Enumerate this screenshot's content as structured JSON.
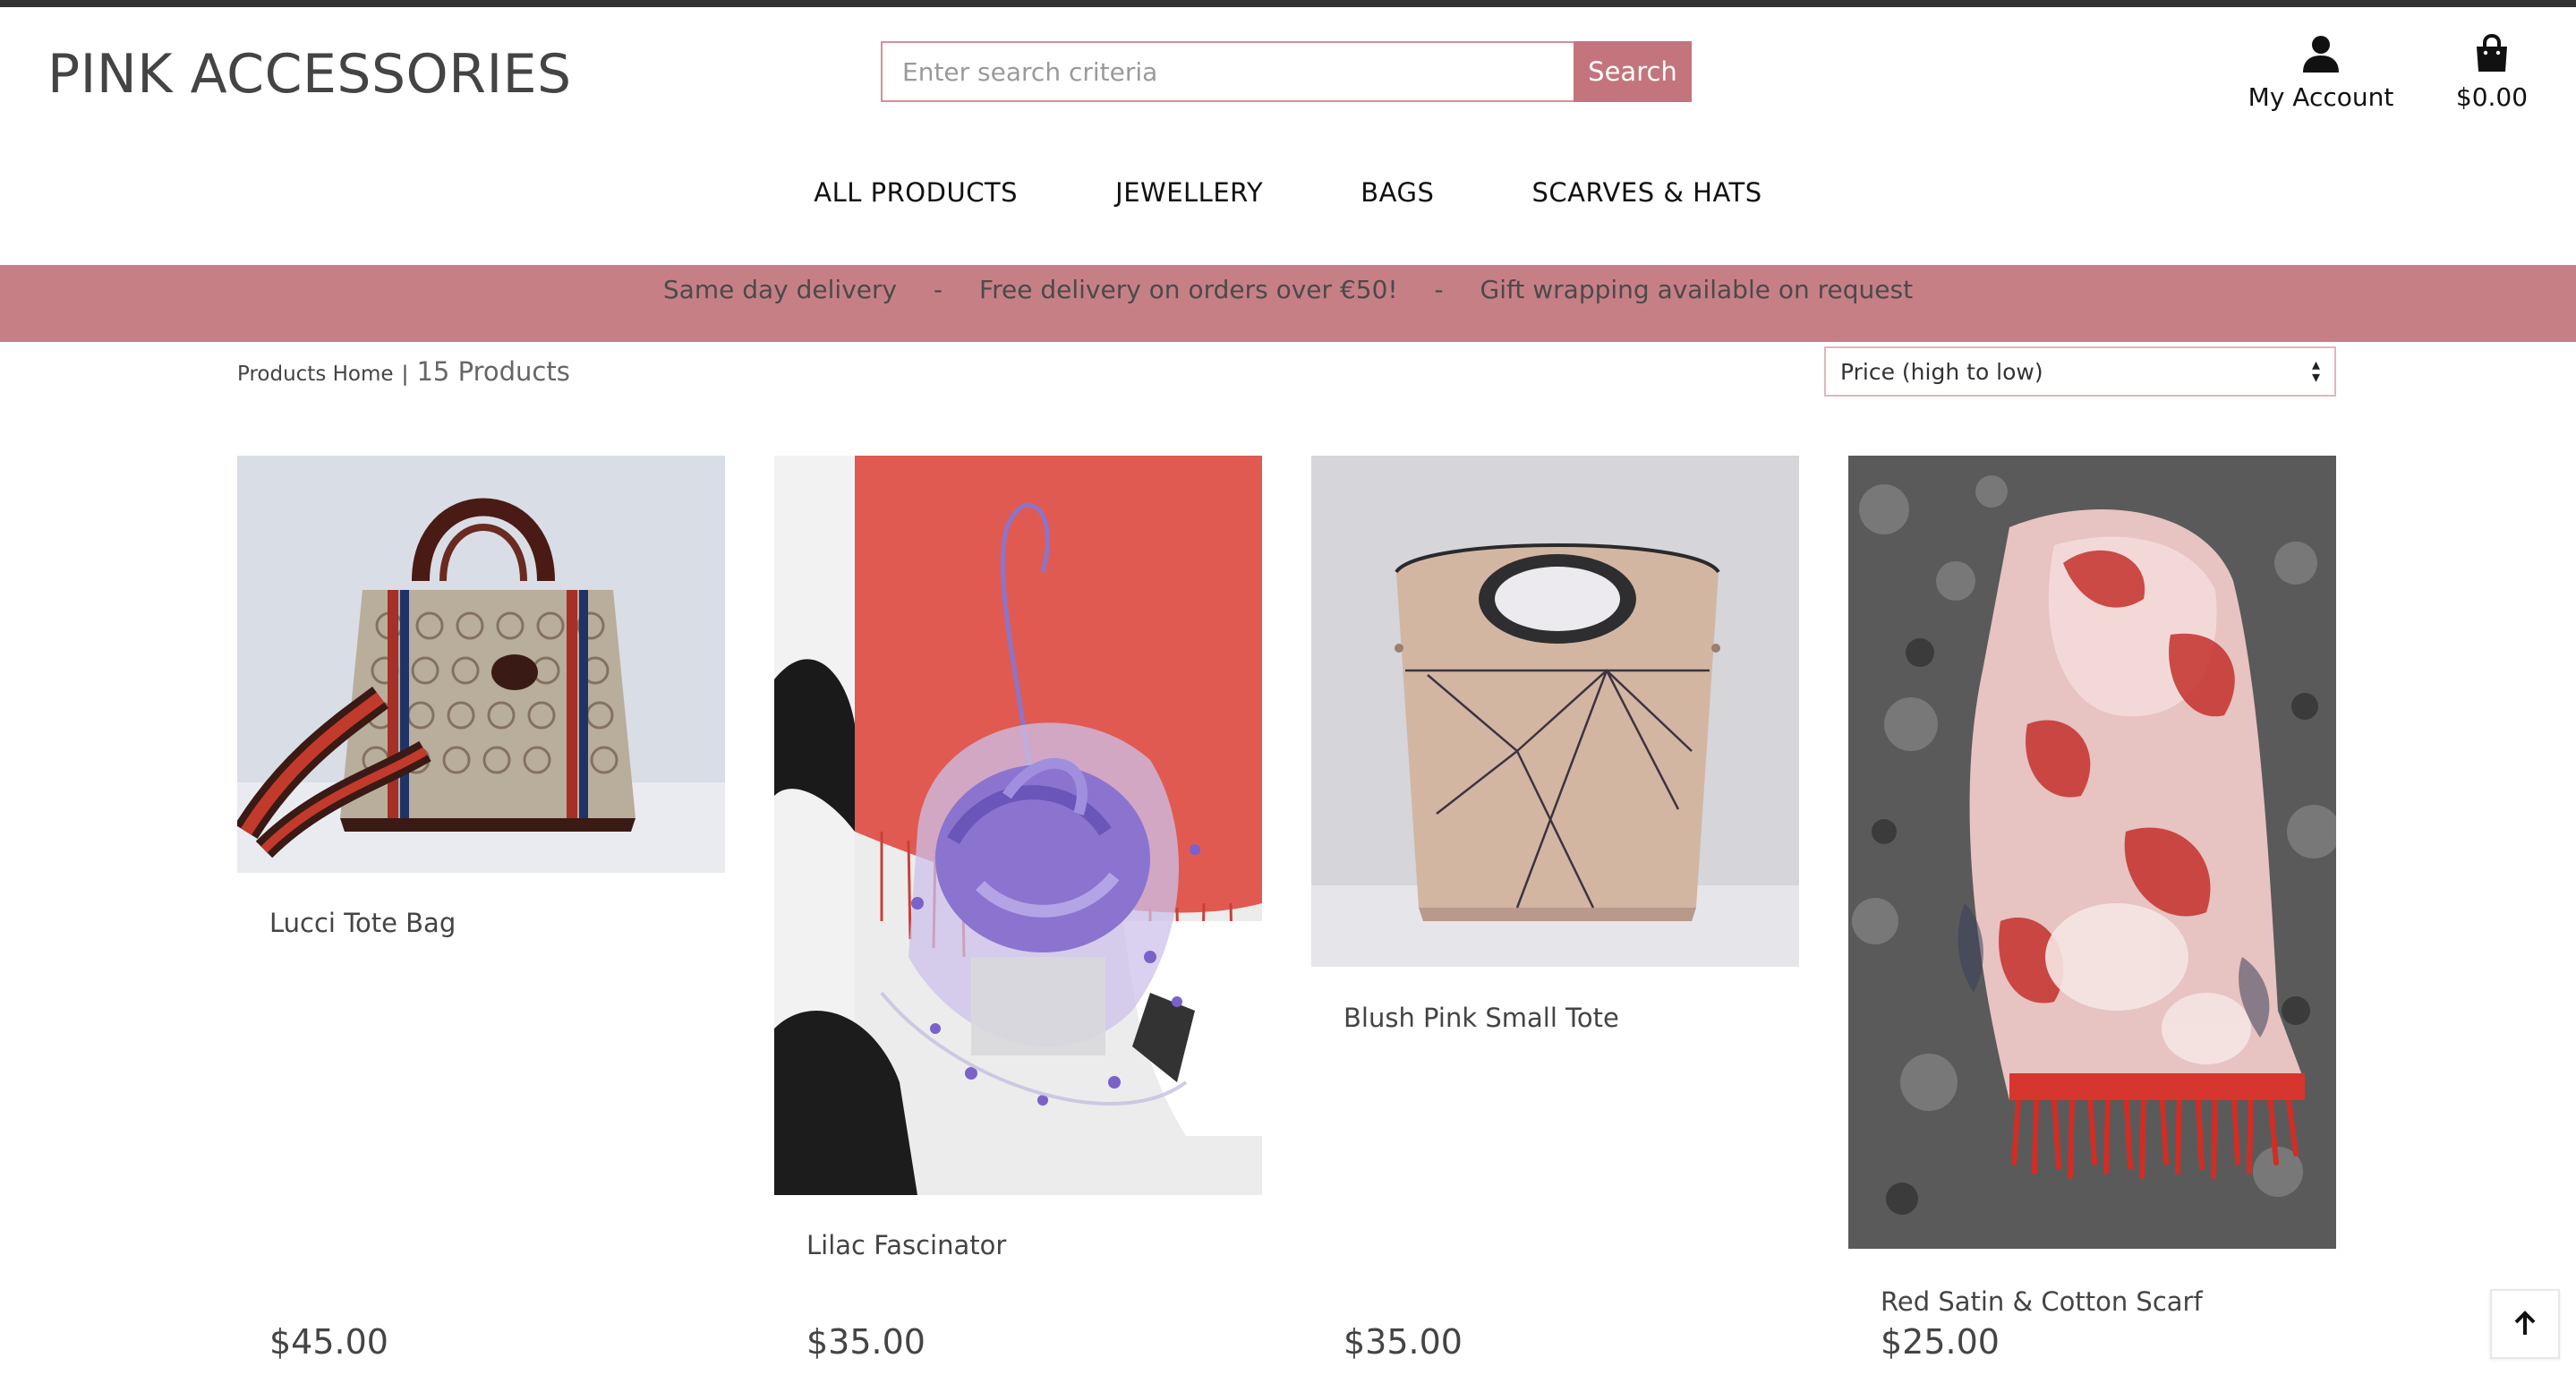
{
  "header": {
    "logo": "PINK ACCESSORIES",
    "search": {
      "placeholder": "Enter search criteria",
      "value": "",
      "button_label": "Search"
    },
    "account_label": "My Account",
    "cart_total": "$0.00"
  },
  "nav": {
    "items": [
      {
        "label": "ALL PRODUCTS"
      },
      {
        "label": "JEWELLERY"
      },
      {
        "label": "BAGS"
      },
      {
        "label": "SCARVES & HATS"
      }
    ]
  },
  "banner": {
    "messages": [
      "Same day delivery",
      "Free delivery on orders over €50!",
      "Gift wrapping available on request"
    ],
    "separator": "-"
  },
  "toolbar": {
    "breadcrumb": "Products Home",
    "breadcrumb_separator": "|",
    "product_count": "15 Products",
    "sort_selected": "Price (high to low)"
  },
  "products": [
    {
      "name": "Lucci Tote Bag",
      "price": "$45.00",
      "image": "tote-bag-photo"
    },
    {
      "name": "Lilac Fascinator",
      "price": "$35.00",
      "image": "fascinator-photo"
    },
    {
      "name": "Blush Pink Small Tote",
      "price": "$35.00",
      "image": "pink-tote-photo"
    },
    {
      "name": "Red Satin & Cotton Scarf",
      "price": "$25.00",
      "image": "scarf-photo"
    }
  ],
  "colors": {
    "accent": "#c4747c",
    "banner": "#c77f86",
    "search_border": "#d68f98",
    "topbar": "#333333"
  },
  "icons": {
    "account": "user-icon",
    "cart": "shopping-bag-icon",
    "back_to_top": "arrow-up-icon",
    "sort": "sort-arrows-icon"
  }
}
